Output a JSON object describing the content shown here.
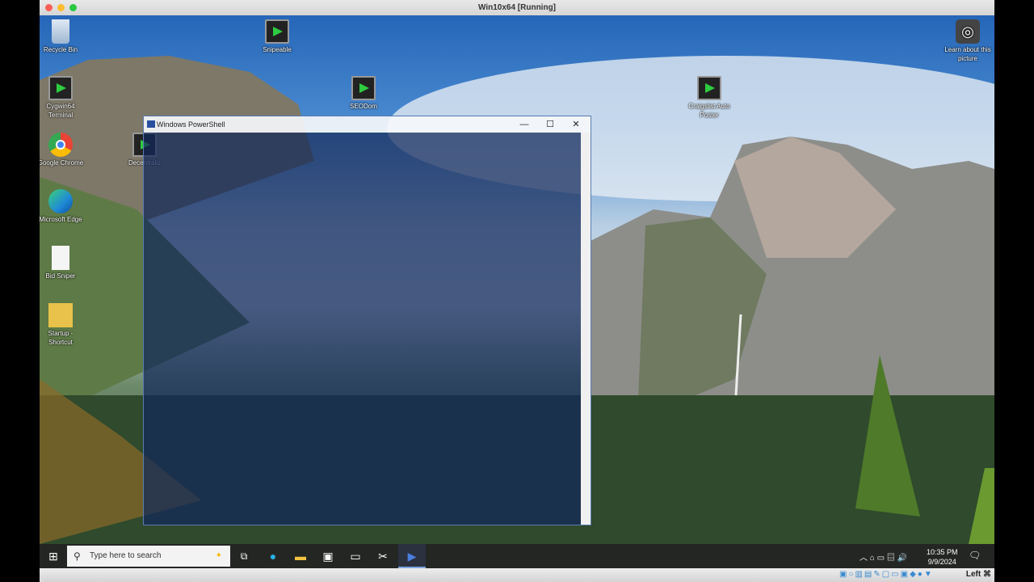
{
  "host": {
    "title": "Win10x64 [Running]",
    "host_key": "Left ⌘"
  },
  "desktop": {
    "icons": [
      {
        "label": "Recycle Bin",
        "icon": "recycle-bin-icon"
      },
      {
        "label": "Snipeable",
        "icon": "terminal-shortcut-icon"
      },
      {
        "label": "Cygwin64 Terminal",
        "icon": "terminal-shortcut-icon"
      },
      {
        "label": "SEODom",
        "icon": "terminal-shortcut-icon"
      },
      {
        "label": "Craigslist Auto Poster",
        "icon": "terminal-shortcut-icon"
      },
      {
        "label": "Google Chrome",
        "icon": "chrome-icon"
      },
      {
        "label": "Decentraliz",
        "icon": "terminal-shortcut-icon"
      },
      {
        "label": "Microsoft Edge",
        "icon": "edge-icon"
      },
      {
        "label": "Bid Sniper",
        "icon": "file-icon"
      },
      {
        "label": "Startup - Shortcut",
        "icon": "folder-shortcut-icon"
      }
    ],
    "learn": "Learn about this picture"
  },
  "powershell": {
    "title": "Windows PowerShell",
    "minimize": "—",
    "maximize": "☐",
    "close": "✕"
  },
  "taskbar": {
    "search_placeholder": "Type here to search",
    "time": "10:35 PM",
    "date": "9/9/2024"
  },
  "colors": {
    "powershell_accent": "#2a4f9e",
    "taskbar": "#121612"
  }
}
